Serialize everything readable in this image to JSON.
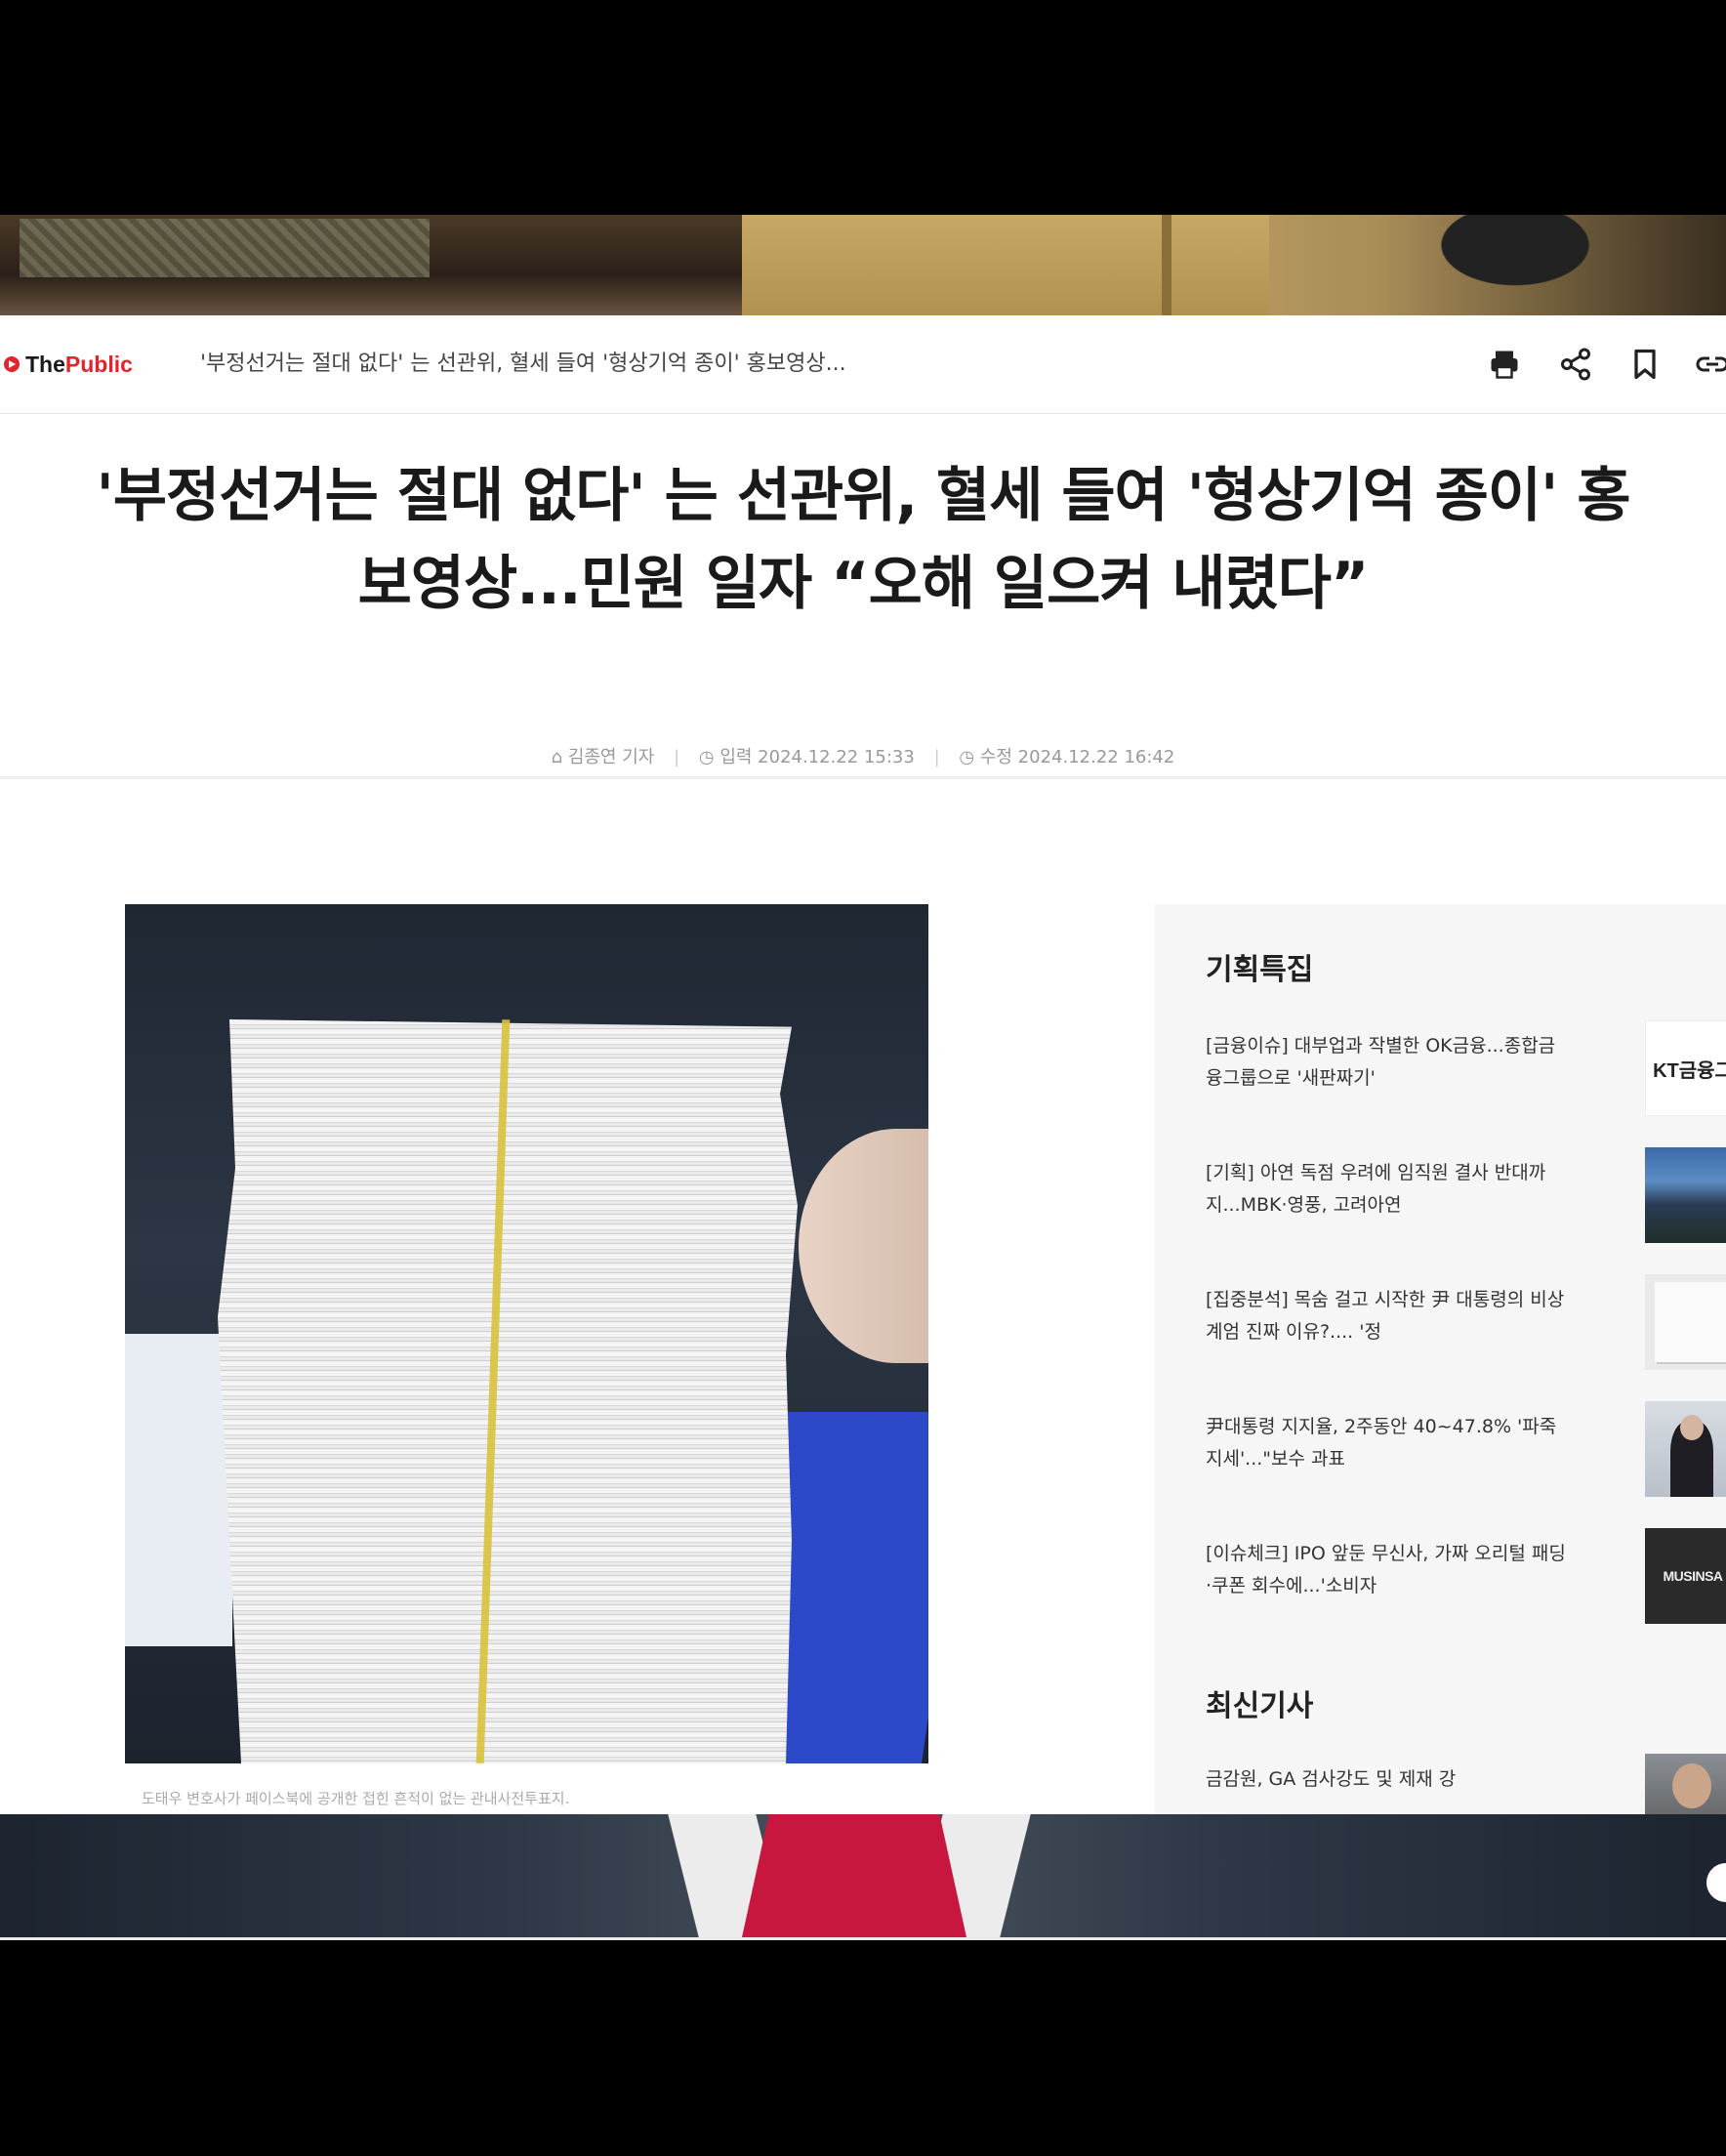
{
  "site": {
    "logo_prefix": "The ",
    "logo_suffix": "Public",
    "bar_title": "'부정선거는 절대 없다' 는 선관위, 혈세 들여 '형상기억 종이' 홍보영상...",
    "tools": [
      "printer-icon",
      "share-icon",
      "bookmark-icon",
      "link-icon"
    ]
  },
  "article": {
    "headline_line1": "'부정선거는 절대 없다' 는 선관위, 혈세 들여 '형상기억 종이' 홍",
    "headline_line2": "보영상...민원 일자 “오해 일으켜 내렸다”",
    "author": "김종연 기자",
    "published": "입력 2024.12.22 15:33",
    "modified": "수정 2024.12.22 16:42",
    "photo_caption": "도태우 변호사가 페이스북에 공개한 접힌 흔적이 없는 관내사전투표지."
  },
  "sidebar": {
    "featured_title": "기획특집",
    "featured": [
      {
        "text": "[금융이슈] 대부업과 작별한 OK금융...종합금융그룹으로 '새판짜기'",
        "thumb": "KT금융그"
      },
      {
        "text": "[기획] 아연 독점 우려에 임직원 결사 반대까지...MBK·영풍, 고려아연",
        "thumb": ""
      },
      {
        "text": "[집중분석] 목숨 걸고 시작한 尹 대통령의 비상계엄 진짜 이유?.... '정",
        "thumb": ""
      },
      {
        "text": "尹대통령 지지율, 2주동안 40~47.8% '파죽지세'...\"보수 과표",
        "thumb": ""
      },
      {
        "text": "[이슈체크] IPO 앞둔 무신사, 가짜 오리털 패딩·쿠폰 회수에...'소비자",
        "thumb": "MUSINSA"
      }
    ],
    "latest_title": "최신기사",
    "latest": [
      {
        "text": "금감원, GA 검사강도 및 제재 강",
        "thumb": ""
      }
    ]
  },
  "colors": {
    "brand_red": "#e3242b",
    "headline": "#1a1a1a",
    "meta": "#999999",
    "sidebar_bg": "#f6f6f6"
  }
}
